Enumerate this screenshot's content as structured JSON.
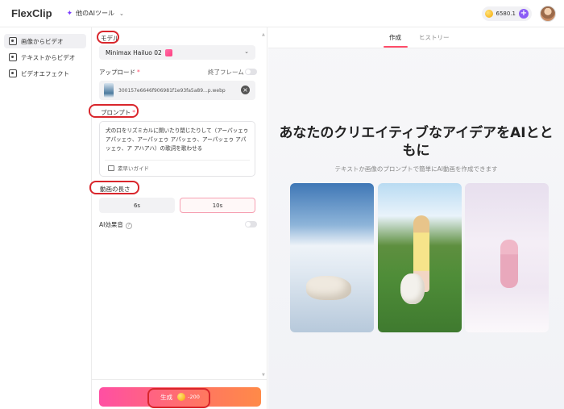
{
  "app": {
    "logo_text": "FlexClip",
    "tools_menu_label": "他のAIツール",
    "credits": "6580.1"
  },
  "sidebar": {
    "items": [
      {
        "label": "画像からビデオ",
        "active": true
      },
      {
        "label": "テキストからビデオ",
        "active": false
      },
      {
        "label": "ビデオエフェクト",
        "active": false
      }
    ]
  },
  "panel": {
    "model_label": "モデル",
    "model_value": "Minimax Hailuo 02",
    "upload_label": "アップロード",
    "end_frame_label": "終了フレーム",
    "file_name": "300157e6646f906981f1e93fa5a89...p.webp",
    "prompt_label": "プロンプト",
    "prompt_text": "犬の口をリズミカルに開いたり閉じたりして（アーパッェゥ アパッェゥ、アーパッェゥ アパッェゥ、アーパッェゥ アパッェゥ、ア アハアハ）の歌詞を歌わせる",
    "guide_label": "素早いガイド",
    "duration_label": "動画の長さ",
    "duration_options": [
      "6s",
      "10s"
    ],
    "duration_selected": "10s",
    "ai_sound_label": "AI効果音",
    "generate_label": "生成",
    "generate_cost": "-200"
  },
  "right": {
    "tabs": [
      "作成",
      "ヒストリー"
    ],
    "headline": "あなたのクリエイティブなアイデアをAIとともに",
    "subline": "テキストか画像のプロンプトで簡単にAI動画を作成できます"
  },
  "colors": {
    "accent": "#ff4d6a",
    "highlight": "#d9262c",
    "purple": "#8b5cf6"
  }
}
